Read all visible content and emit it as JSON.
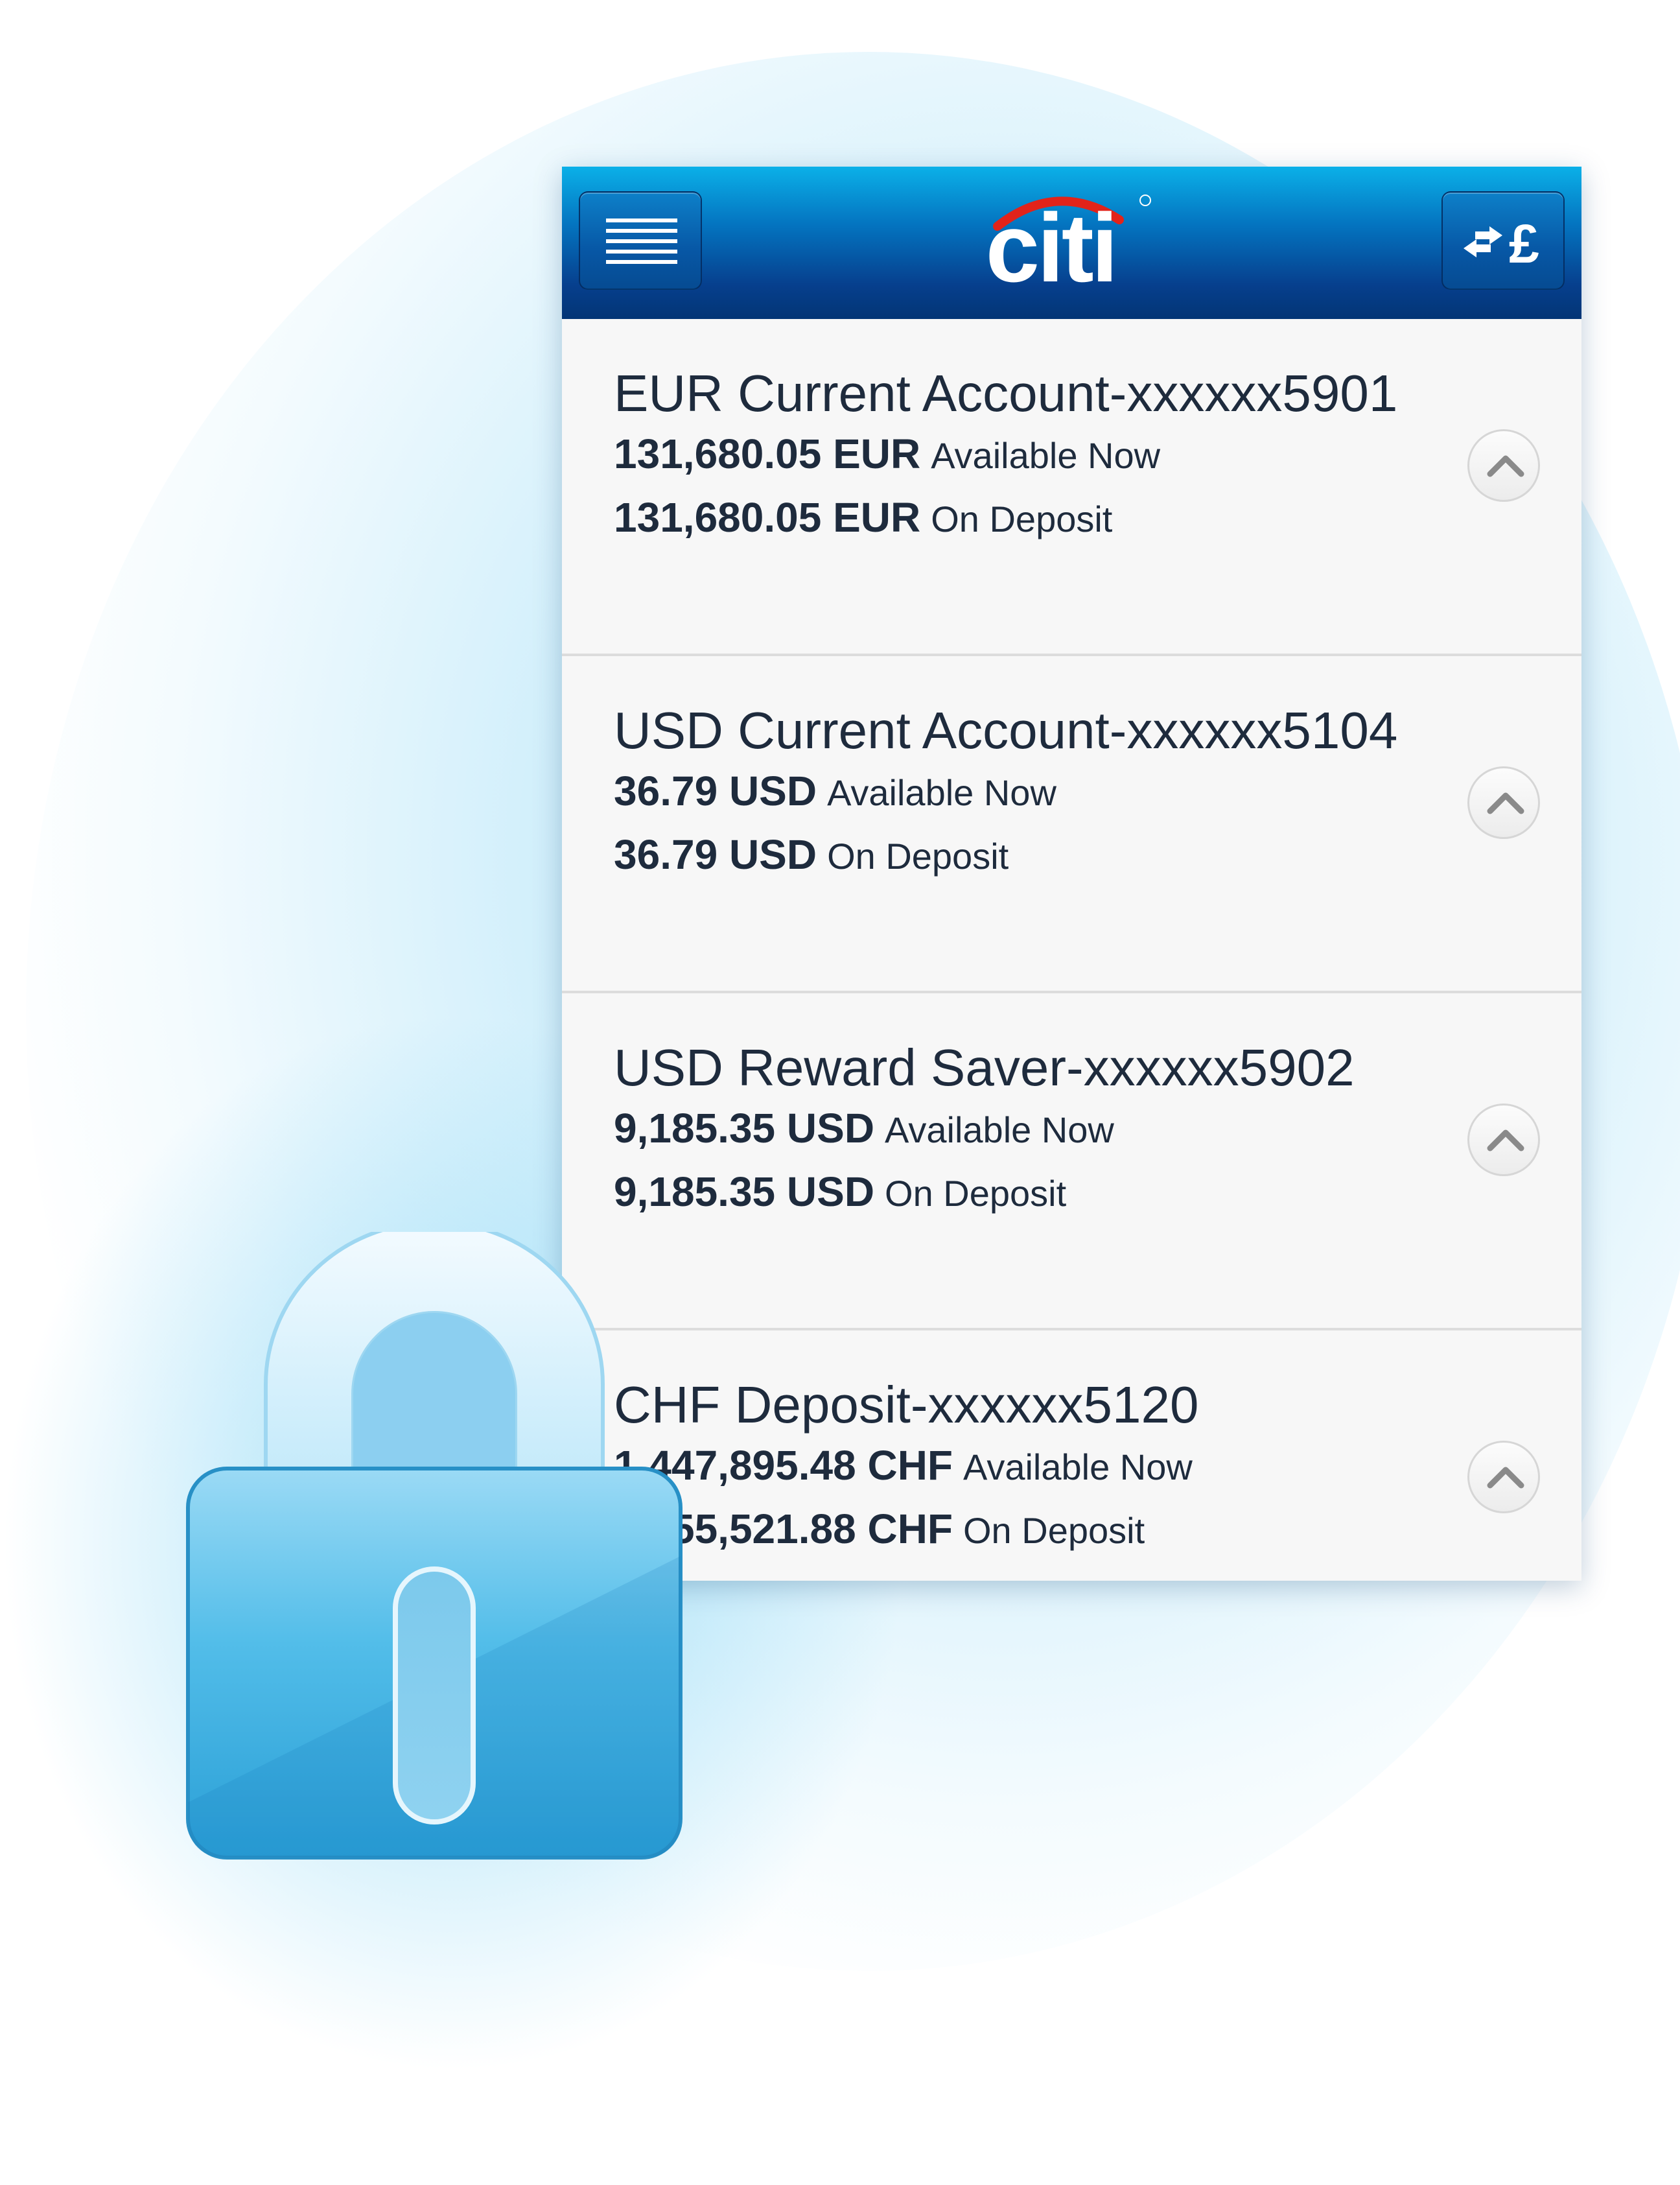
{
  "app": {
    "logo_text": "citi",
    "menu_icon": "hamburger-menu-icon",
    "transfer_icon": "currency-transfer-icon",
    "transfer_currency_symbol": "£"
  },
  "accounts": [
    {
      "title": "EUR Current Account-xxxxxx5901",
      "available_amount": "131,680.05 EUR",
      "available_label": "Available Now",
      "deposit_amount": "131,680.05 EUR",
      "deposit_label": "On Deposit"
    },
    {
      "title": "USD Current Account-xxxxxx5104",
      "available_amount": "36.79 USD",
      "available_label": "Available Now",
      "deposit_amount": "36.79 USD",
      "deposit_label": "On Deposit"
    },
    {
      "title": "USD Reward Saver-xxxxxx5902",
      "available_amount": "9,185.35 USD",
      "available_label": "Available Now",
      "deposit_amount": "9,185.35 USD",
      "deposit_label": "On Deposit"
    },
    {
      "title": "CHF Deposit-xxxxxx5120",
      "available_amount": "1,447,895.48 CHF",
      "available_label": "Available Now",
      "deposit_amount": "1,455,521.88 CHF",
      "deposit_label": "On Deposit"
    }
  ],
  "colors": {
    "header_dark": "#033575",
    "header_light": "#0bb0e8",
    "logo_arc": "#e2231a",
    "lock_body": "#3cb0e0",
    "text": "#1e2b3d"
  },
  "decor": {
    "lock_icon": "padlock-icon",
    "chevron_icon": "chevron-up-icon"
  }
}
